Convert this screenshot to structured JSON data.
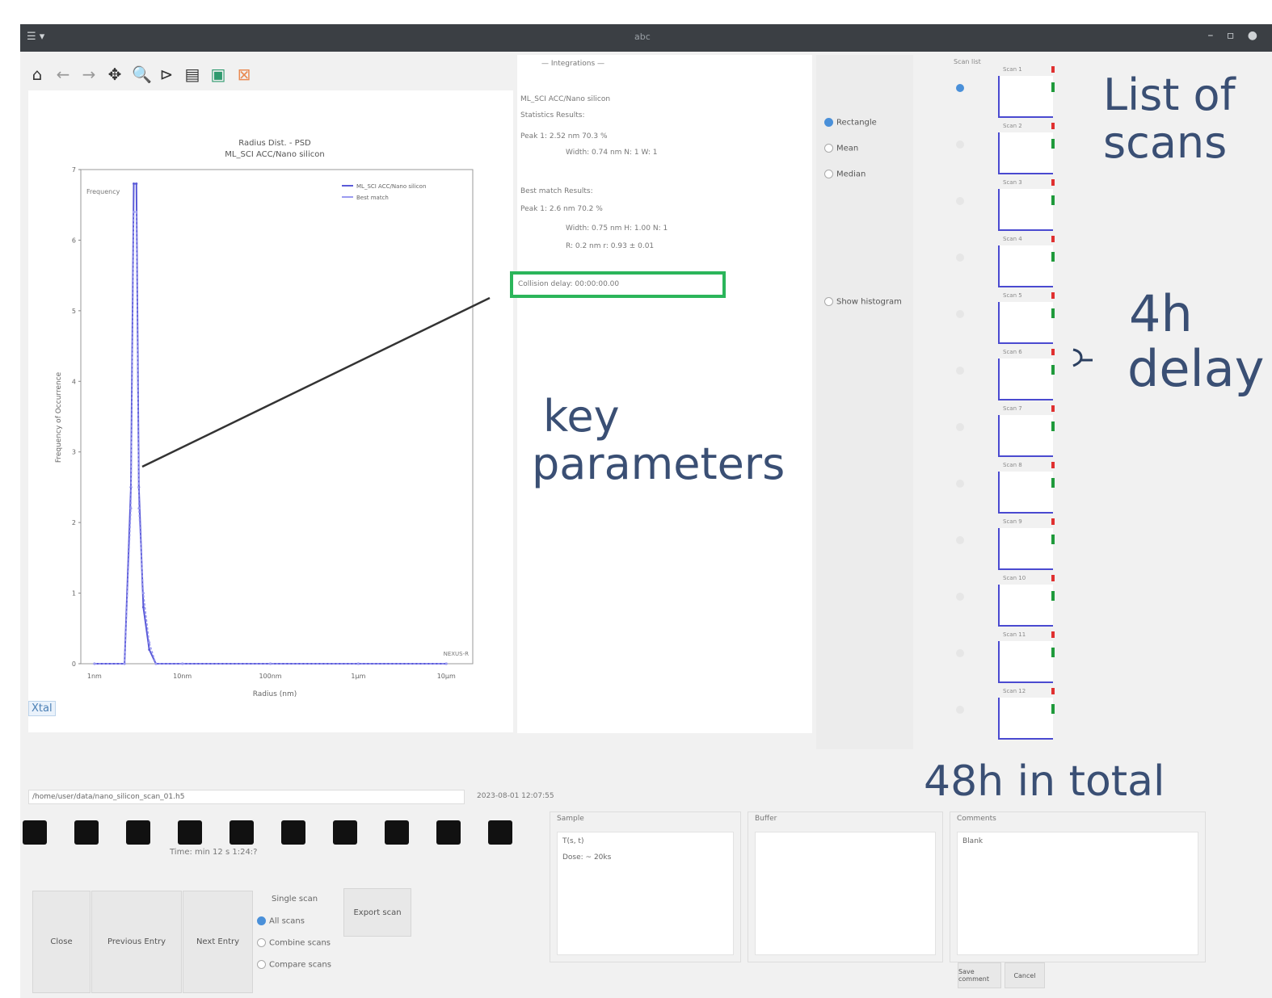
{
  "window": {
    "title": "abc",
    "left_glyphs": "☰ ▾",
    "right_glyphs": "– ▫ ●"
  },
  "toolbar": {
    "icons": [
      "home-icon",
      "back-icon",
      "forward-icon",
      "pan-icon",
      "zoom-icon",
      "subplots-icon",
      "save-icon",
      "export-icon",
      "clear-icon"
    ]
  },
  "plot": {
    "title_line1": "Radius Dist. - PSD",
    "title_line2": "ML_SCI ACC/Nano silicon",
    "legend": [
      "ML_SCI ACC/Nano silicon",
      "Best match"
    ],
    "ylabel": "Frequency of Occurrence",
    "xlabel": "Radius (nm)",
    "xticks": [
      "1nm",
      "10nm",
      "100nm",
      "1μm",
      "10μm"
    ],
    "yticks": [
      "0",
      "1",
      "2",
      "3",
      "4",
      "5",
      "6",
      "7"
    ],
    "corner_label": "Frequency",
    "footer_right": "NEXUS-R",
    "toggle_label": "Xtal"
  },
  "chart_data": {
    "type": "line",
    "title": "Radius Dist. - PSD",
    "subtitle": "ML_SCI ACC/Nano silicon",
    "xlabel": "Radius (nm)",
    "ylabel": "Frequency of Occurrence",
    "x_scale": "log",
    "xlim": [
      0.7,
      20000
    ],
    "ylim": [
      0,
      7
    ],
    "series": [
      {
        "name": "ML_SCI ACC/Nano silicon",
        "x": [
          1,
          2.2,
          2.6,
          2.8,
          3.0,
          3.2,
          3.6,
          4.2,
          5,
          10,
          100,
          1000,
          10000
        ],
        "y": [
          0,
          0,
          2.5,
          6.8,
          6.8,
          2.5,
          0.8,
          0.2,
          0,
          0,
          0,
          0,
          0
        ]
      },
      {
        "name": "Best match",
        "x": [
          1,
          2.2,
          2.6,
          2.8,
          3.0,
          3.2,
          3.6,
          4.2,
          5,
          10,
          100,
          1000,
          10000
        ],
        "y": [
          0,
          0,
          2.2,
          6.4,
          6.4,
          2.2,
          1.0,
          0.3,
          0,
          0,
          0,
          0,
          0
        ]
      }
    ],
    "grid": false,
    "legend_position": "top-right"
  },
  "results": {
    "header": "— Integrations —",
    "lines": [
      "ML_SCI ACC/Nano silicon",
      "Statistics Results:",
      "Peak 1: 2.52 nm  70.3 %",
      "      Width: 0.74 nm  N: 1  W: 1",
      "",
      "Best match Results:",
      "Peak 1: 2.6 nm  70.2 %",
      "      Width: 0.75 nm  H: 1.00  N: 1",
      "      R: 0.2 nm  r: 0.93 ± 0.01"
    ],
    "highlight": "Collision delay: 00:00:00.00"
  },
  "radio": {
    "options": [
      "Rectangle",
      "Mean",
      "Median"
    ],
    "selected": 0,
    "extra": "Show histogram"
  },
  "scans": {
    "label": "Scan list",
    "items": [
      {
        "label": "Scan 1",
        "checked": true
      },
      {
        "label": "Scan 2",
        "checked": false
      },
      {
        "label": "Scan 3",
        "checked": false
      },
      {
        "label": "Scan 4",
        "checked": false
      },
      {
        "label": "Scan 5",
        "checked": false
      },
      {
        "label": "Scan 6",
        "checked": false
      },
      {
        "label": "Scan 7",
        "checked": false
      },
      {
        "label": "Scan 8",
        "checked": false
      },
      {
        "label": "Scan 9",
        "checked": false
      },
      {
        "label": "Scan 10",
        "checked": false
      },
      {
        "label": "Scan 11",
        "checked": false
      },
      {
        "label": "Scan 12",
        "checked": false
      }
    ]
  },
  "annotations": {
    "list_of_scans_1": "List of",
    "list_of_scans_2": "scans",
    "delay_4h_1": "4h",
    "delay_4h_2": "delay",
    "brace": "}",
    "key_1": "key",
    "key_2": "parameters",
    "total_48h": "48h in total"
  },
  "file": {
    "path": "/home/user/data/nano_silicon_scan_01.h5",
    "meta": "2023-08-01 12:07:55"
  },
  "time_row": "Time: min  12  s  1:24:?",
  "buttons": {
    "close": "Close",
    "previous": "Previous Entry",
    "next": "Next Entry",
    "export": "Export scan"
  },
  "modes": {
    "options": [
      "Single scan",
      "All scans",
      "Combine scans",
      "Compare scans"
    ],
    "selected": 1
  },
  "groups": {
    "sample_title": "Sample",
    "sample_lines": [
      "T(s, t)",
      "Dose: ~ 20ks"
    ],
    "buffer_title": "Buffer",
    "comments_title": "Comments",
    "comments_lines": [
      "Blank"
    ],
    "save_comment": "Save comment",
    "cancel": "Cancel"
  }
}
